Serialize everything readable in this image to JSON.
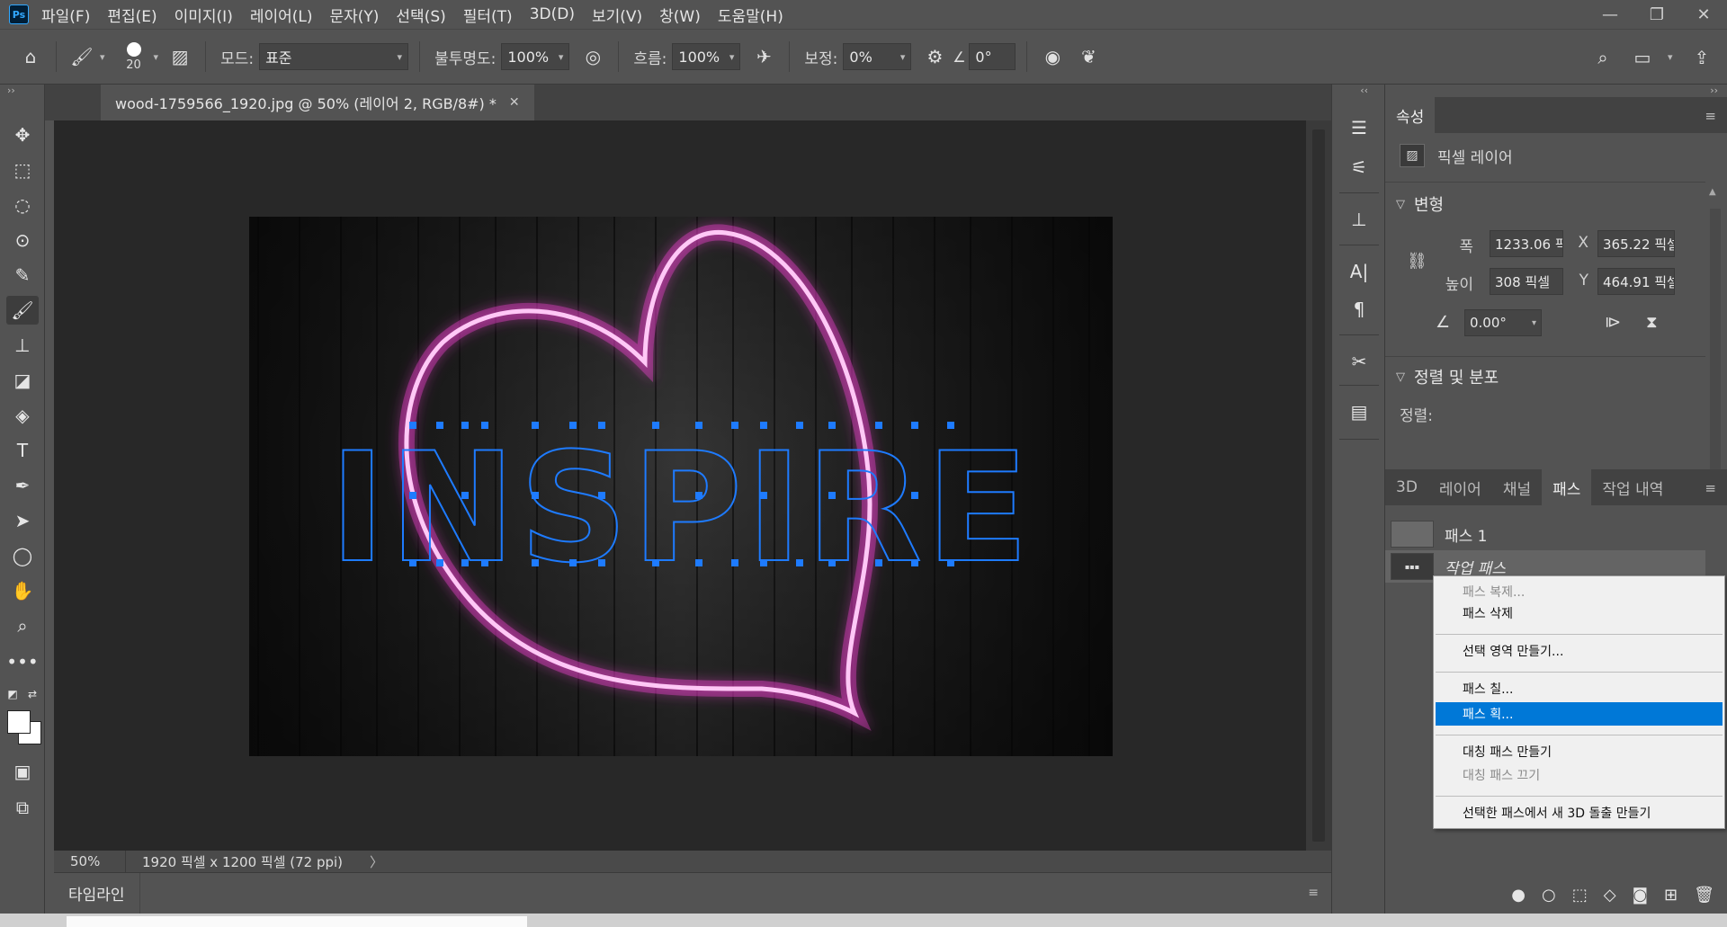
{
  "app": {
    "logo": "Ps",
    "menu": [
      "파일(F)",
      "편집(E)",
      "이미지(I)",
      "레이어(L)",
      "문자(Y)",
      "선택(S)",
      "필터(T)",
      "3D(D)",
      "보기(V)",
      "창(W)",
      "도움말(H)"
    ],
    "window_controls": {
      "minimize": "—",
      "restore": "❐",
      "close": "✕"
    }
  },
  "options_bar": {
    "brush_size": "20",
    "mode_label": "모드:",
    "mode_value": "표준",
    "opacity_label": "불투명도:",
    "opacity_value": "100%",
    "flow_label": "흐름:",
    "flow_value": "100%",
    "smoothing_label": "보정:",
    "smoothing_value": "0%",
    "angle_value": "0°"
  },
  "document": {
    "tab_title": "wood-1759566_1920.jpg @ 50% (레이어 2, RGB/8#) *",
    "canvas_text": "INSPIRE",
    "zoom": "50%",
    "dimensions": "1920 픽셀 x 1200 픽셀 (72 ppi)",
    "timeline_label": "타임라인"
  },
  "properties_panel": {
    "tab": "속성",
    "layer_type": "픽셀 레이어",
    "transform_section": "변형",
    "width_label": "폭",
    "width_value": "1233.06 픽셀",
    "height_label": "높이",
    "height_value": "308 픽셀",
    "x_label": "X",
    "x_value": "365.22 픽셀",
    "y_label": "Y",
    "y_value": "464.91 픽셀",
    "angle_value": "0.00°",
    "align_section": "정렬 및 분포",
    "align_label": "정렬:"
  },
  "paths_panel": {
    "tabs": [
      "3D",
      "레이어",
      "채널",
      "패스",
      "작업 내역"
    ],
    "active_tab": "패스",
    "paths": [
      {
        "name": "패스 1",
        "selected": false
      },
      {
        "name": "작업 패스",
        "selected": true
      }
    ]
  },
  "context_menu": {
    "items": [
      {
        "label": "패스 복제...",
        "enabled": false,
        "highlighted": false
      },
      {
        "label": "패스 삭제",
        "enabled": true,
        "highlighted": false
      },
      {
        "label": "선택 영역 만들기...",
        "enabled": true,
        "highlighted": false
      },
      {
        "label": "패스 칠...",
        "enabled": true,
        "highlighted": false
      },
      {
        "label": "패스 획...",
        "enabled": true,
        "highlighted": true
      },
      {
        "label": "대칭 패스 만들기",
        "enabled": true,
        "highlighted": false
      },
      {
        "label": "대칭 패스 끄기",
        "enabled": false,
        "highlighted": false
      },
      {
        "label": "선택한 패스에서 새 3D 돌출 만들기",
        "enabled": true,
        "highlighted": false
      }
    ]
  },
  "colors": {
    "neon": "#ff4bd8",
    "path_blue": "#1e7bff",
    "highlight": "#0078d7"
  }
}
